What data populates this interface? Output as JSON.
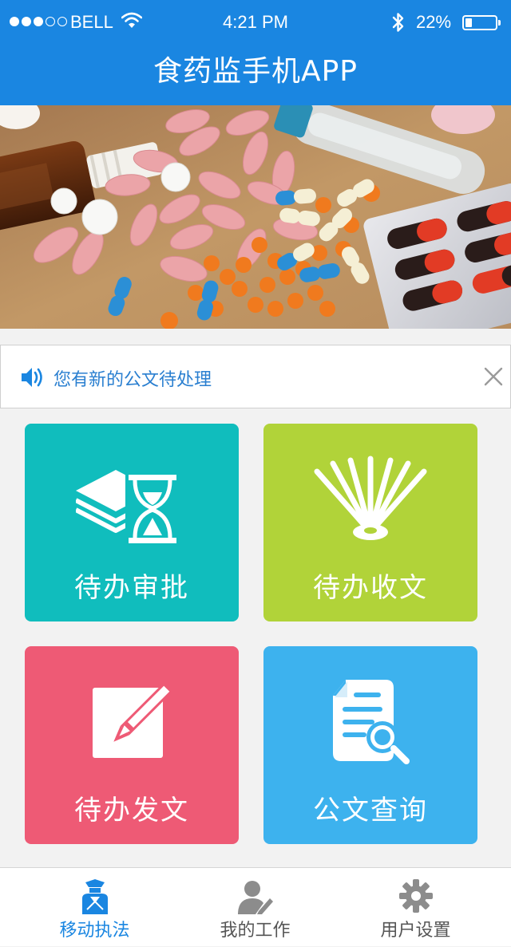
{
  "status_bar": {
    "carrier": "BELL",
    "time": "4:21 PM",
    "battery_percent": "22%",
    "battery_level": 0.22,
    "signal_bars_filled": 3,
    "signal_bars_total": 5
  },
  "header": {
    "title": "食药监手机APP"
  },
  "banner": {
    "slide_count": 3,
    "active_slide": 3
  },
  "notice": {
    "text": "您有新的公文待处理",
    "icon": "speaker-icon",
    "close_icon": "close-icon"
  },
  "tiles": [
    {
      "label": "待办审批",
      "icon": "stack-hourglass-icon",
      "color": "#10bdbd"
    },
    {
      "label": "待办收文",
      "icon": "open-book-icon",
      "color": "#b1d339"
    },
    {
      "label": "待办发文",
      "icon": "pencil-square-icon",
      "color": "#ee5a75"
    },
    {
      "label": "公文查询",
      "icon": "document-search-icon",
      "color": "#3db2ee"
    }
  ],
  "tabbar": {
    "active_color": "#1a86e1",
    "items": [
      {
        "label": "移动执法",
        "icon": "officer-icon",
        "active": true
      },
      {
        "label": "我的工作",
        "icon": "user-edit-icon",
        "active": false
      },
      {
        "label": "用户设置",
        "icon": "gear-icon",
        "active": false
      }
    ]
  }
}
